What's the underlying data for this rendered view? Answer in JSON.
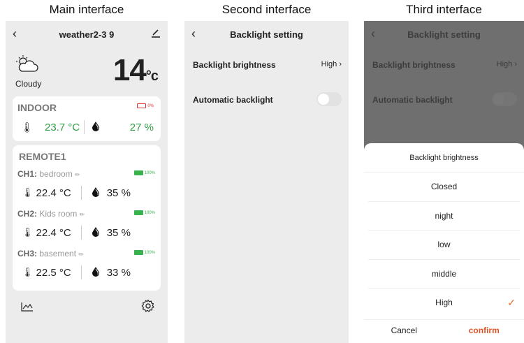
{
  "captions": [
    "Main interface",
    "Second interface",
    "Third interface"
  ],
  "main": {
    "title": "weather2-3 9",
    "condition": "Cloudy",
    "outdoor_temp": "14",
    "temp_unit": "°c",
    "indoor": {
      "title": "INDOOR",
      "battery": "0%",
      "temperature": "23.7 °C",
      "humidity": "27 %"
    },
    "remote": {
      "title": "REMOTE1",
      "channels": [
        {
          "id": "CH1:",
          "name": "bedroom",
          "battery": "100%",
          "temperature": "22.4 °C",
          "humidity": "35 %"
        },
        {
          "id": "CH2:",
          "name": "Kids room",
          "battery": "100%",
          "temperature": "22.4 °C",
          "humidity": "35 %"
        },
        {
          "id": "CH3:",
          "name": "basement",
          "battery": "100%",
          "temperature": "22.5 °C",
          "humidity": "33 %"
        }
      ]
    },
    "colors": {
      "good": "#2f9e44",
      "battery_low": "#e03131",
      "battery_full": "#37b24d"
    }
  },
  "backlight": {
    "title": "Backlight setting",
    "brightness_label": "Backlight brightness",
    "brightness_value": "High",
    "auto_label": "Automatic backlight",
    "auto_enabled": false
  },
  "sheet": {
    "title": "Backlight brightness",
    "options": [
      "Closed",
      "night",
      "low",
      "middle",
      "High"
    ],
    "selected": "High",
    "cancel": "Cancel",
    "confirm": "confirm",
    "accent": "#e8692a"
  }
}
